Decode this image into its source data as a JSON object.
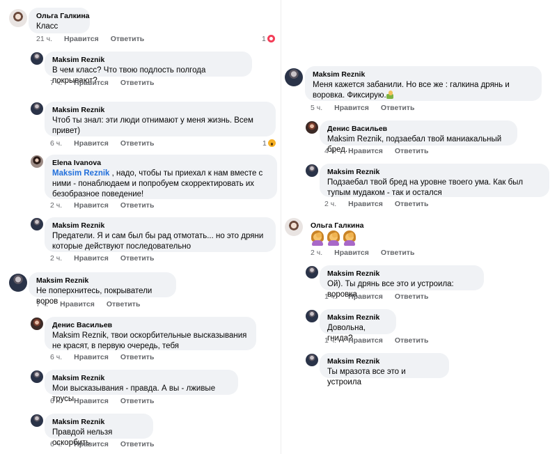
{
  "labels": {
    "like": "Нравится",
    "reply": "Ответить"
  },
  "left": {
    "c1": {
      "name": "Ольга Галкина",
      "text": "Класс",
      "time": "21 ч.",
      "reactions": "1"
    },
    "c2": {
      "name": "Maksim Reznik",
      "text": "В чем класс? Что твою подлость полгода покрывают?",
      "time": "7 ч."
    },
    "c3": {
      "name": "Maksim Reznik",
      "text": "Чтоб ты знал: эти люди отнимают у меня жизнь. Всем привет)",
      "time": "6 ч.",
      "reactions": "1"
    },
    "c4": {
      "name": "Elena Ivanova",
      "mention": "Maksim Reznik",
      "text": " , надо, чтобы ты приехал к нам вместе с ними - понаблюдаем и попробуем скорректировать их безобразное поведение!",
      "time": "2 ч."
    },
    "c5": {
      "name": "Maksim Reznik",
      "text": "Предатели. Я и сам был бы рад отмотать... но это дряни которые действуют последовательно",
      "time": "2 ч."
    },
    "c6": {
      "name": "Maksim Reznik",
      "text": "Не поперхнитесь, покрыватели воров",
      "time": "7 ч."
    },
    "c7": {
      "name": "Денис Васильев",
      "text": "Maksim Reznik, твои оскорбительные высказывания не красят, в первую очередь, тебя",
      "time": "6 ч."
    },
    "c8": {
      "name": "Maksim Reznik",
      "text": "Мои высказывания - правда. А вы - лживые трусы.",
      "time": "6 ч."
    },
    "c9": {
      "name": "Maksim Reznik",
      "text": "Правдой нельзя оскорбить",
      "time": "6 ч."
    }
  },
  "right": {
    "r1": {
      "name": "Maksim Reznik",
      "text": "Меня кажется забанили. Но все же : галкина дрянь и воровка. Фиксирую.",
      "time": "5 ч."
    },
    "r2": {
      "name": "Денис Васильев",
      "text": "Maksim Reznik, подзаебал твой маниакальный бред.",
      "time": "4 ч."
    },
    "r3": {
      "name": "Maksim Reznik",
      "text": "Подзаебал твой бред на уровне твоего ума. Как был тупым мудаком - так и остался",
      "time": "2 ч."
    },
    "r4": {
      "name": "Ольга Галкина",
      "time": "2 ч.",
      "emoji_icons": [
        "woman-facepalming-icon",
        "woman-facepalming-icon",
        "woman-facepalming-icon"
      ]
    },
    "r5": {
      "name": "Maksim Reznik",
      "text": "Ой). Ты дрянь все это и устроила: воровка",
      "time": "1 ч."
    },
    "r6": {
      "name": "Maksim Reznik",
      "text": "Довольна, гнида?",
      "time": "1 ч."
    },
    "r7": {
      "name": "Maksim Reznik",
      "text": "Ты мразота все это и устроила",
      "time": "1 ч."
    }
  }
}
